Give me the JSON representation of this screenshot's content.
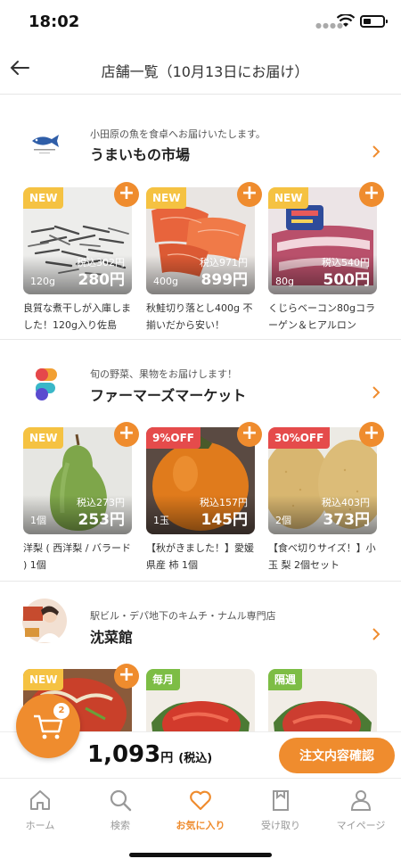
{
  "status": {
    "time": "18:02"
  },
  "header": {
    "title": "店舗一覧（10月13日にお届け）"
  },
  "shops": [
    {
      "tagline": "小田原の魚を食卓へお届けいたします。",
      "name": "うまいもの市場",
      "products": [
        {
          "badge": "NEW",
          "unit": "120g",
          "tax_in": "税込302円",
          "price": "280円",
          "name": "良質な煮干しが入庫しました！120g入り佐島"
        },
        {
          "badge": "NEW",
          "unit": "400g",
          "tax_in": "税込971円",
          "price": "899円",
          "name": "秋鮭切り落とし400g 不揃いだから安い！"
        },
        {
          "badge": "NEW",
          "unit": "80g",
          "tax_in": "税込540円",
          "price": "500円",
          "name": "くじらベーコン80gコラーゲン＆ヒアルロン"
        }
      ]
    },
    {
      "tagline": "旬の野菜、果物をお届けします！",
      "name": "ファーマーズマーケット",
      "products": [
        {
          "badge": "NEW",
          "unit": "1個",
          "tax_in": "税込273円",
          "price": "253円",
          "name": "洋梨 ( 西洋梨 / バラード ) 1個"
        },
        {
          "badge": "9%OFF",
          "unit": "1玉",
          "tax_in": "税込157円",
          "price": "145円",
          "name": "【秋がきました！】愛媛県産 柿 1個"
        },
        {
          "badge": "30%OFF",
          "unit": "2個",
          "tax_in": "税込403円",
          "price": "373円",
          "name": "【食べ切りサイズ！】小玉 梨 2個セット"
        }
      ]
    },
    {
      "tagline": "駅ビル・デパ地下のキムチ・ナムル専門店",
      "name": "沈菜館",
      "products": [
        {
          "badge": "NEW"
        },
        {
          "badge": "毎月"
        },
        {
          "badge": "隔週"
        }
      ]
    }
  ],
  "cart": {
    "count": "2",
    "total": "1,093",
    "yen": "円",
    "tax_label": "(税込)",
    "confirm_label": "注文内容確認"
  },
  "tabs": [
    {
      "label": "ホーム",
      "icon": "home-icon"
    },
    {
      "label": "検索",
      "icon": "search-icon"
    },
    {
      "label": "お気に入り",
      "icon": "heart-icon",
      "active": true
    },
    {
      "label": "受け取り",
      "icon": "bag-icon"
    },
    {
      "label": "マイページ",
      "icon": "person-icon"
    }
  ],
  "colors": {
    "accent": "#ef8c2e",
    "new_badge": "#f5c242",
    "off_badge": "#e54b4b",
    "freq_badge": "#7dbd45"
  }
}
